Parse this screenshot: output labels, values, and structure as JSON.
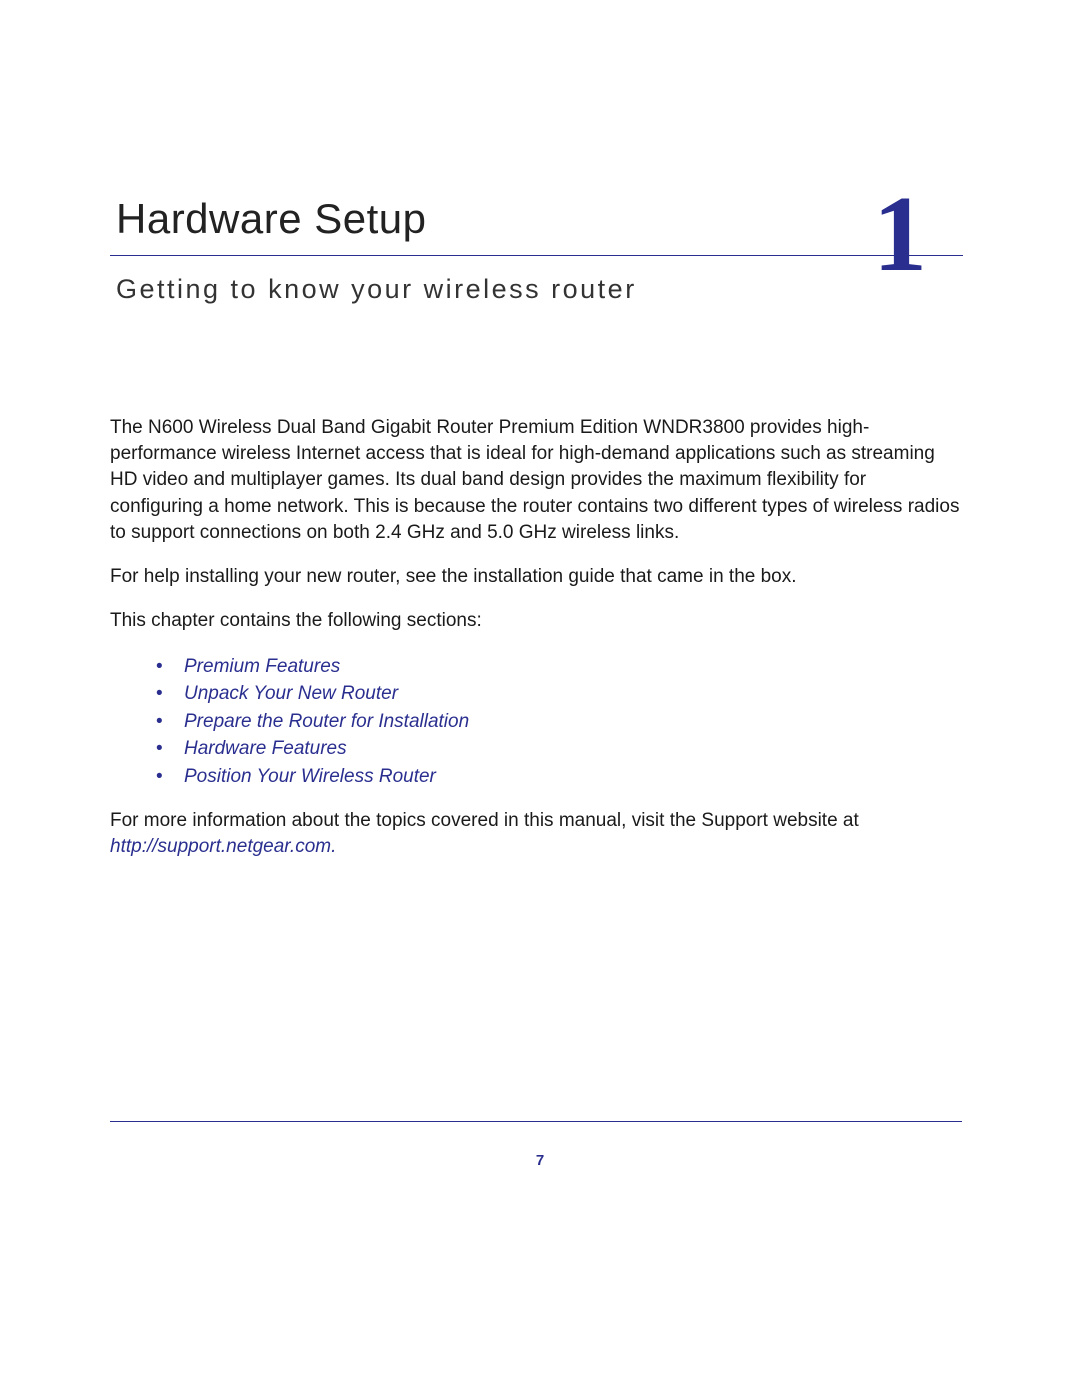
{
  "chapter": {
    "title": "Hardware Setup",
    "subtitle": "Getting to know your wireless router",
    "number": "1"
  },
  "paragraphs": {
    "intro": "The N600 Wireless Dual Band Gigabit Router Premium Edition WNDR3800 provides high-performance wireless Internet access that is ideal for high-demand applications such as streaming HD video and multiplayer games. Its dual band design provides the maximum flexibility for configuring a home network. This is because the router contains two different types of wireless radios to support connections on both 2.4 GHz and 5.0 GHz wireless links.",
    "help": "For help installing your new router, see the installation guide that came in the box.",
    "sectionsIntro": "This chapter contains the following sections:",
    "moreInfoPrefix": "For more information about the topics covered in this manual, visit the Support website at ",
    "moreInfoLink": "http://support.netgear.com",
    "moreInfoSuffix": "."
  },
  "sections": [
    "Premium Features",
    "Unpack Your New Router",
    "Prepare the Router for Installation",
    "Hardware Features",
    "Position Your Wireless Router"
  ],
  "pageNumber": "7"
}
